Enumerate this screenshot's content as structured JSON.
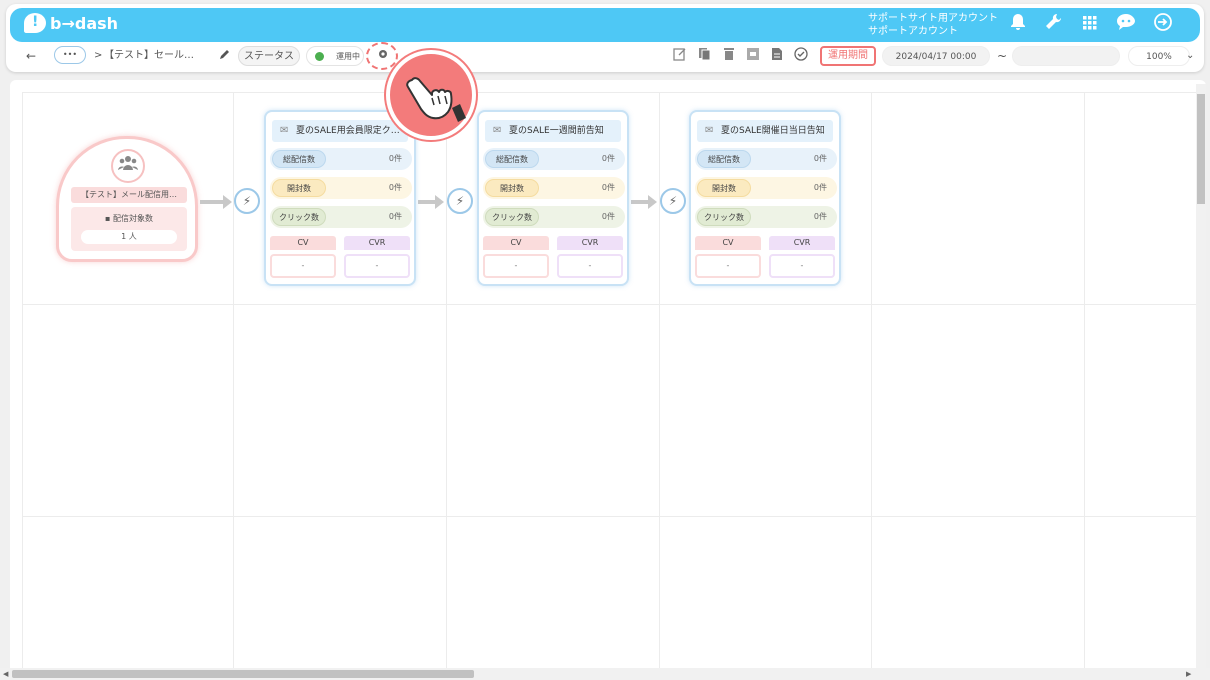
{
  "brand": {
    "logo_text": "b→dash"
  },
  "account": {
    "line1": "サポートサイト用アカウント",
    "line2": "サポートアカウント"
  },
  "header_icons": [
    "bell-icon",
    "wrench-icon",
    "grid-icon",
    "chat-icon",
    "logout-icon"
  ],
  "toolbar": {
    "back": "←",
    "more": "•••",
    "breadcrumb_sep": ">",
    "breadcrumb": "【テスト】セール…",
    "status_label": "ステータス",
    "status_value": "運用中",
    "period_button": "運用期間",
    "start_date": "2024/04/17 00:00",
    "tilde": "~",
    "end_date": "",
    "zoom": "100%"
  },
  "start_node": {
    "title": "【テスト】メール配信用…",
    "sub_label": "配信対象数",
    "sub_value": "1 人"
  },
  "mail_nodes": [
    {
      "title": "夏のSALE用会員限定ク…",
      "rows": [
        {
          "label": "総配信数",
          "value": "0件"
        },
        {
          "label": "開封数",
          "value": "0件"
        },
        {
          "label": "クリック数",
          "value": "0件"
        }
      ],
      "cv_label": "CV",
      "cv_value": "-",
      "cvr_label": "CVR",
      "cvr_value": "-"
    },
    {
      "title": "夏のSALE一週間前告知",
      "rows": [
        {
          "label": "総配信数",
          "value": "0件"
        },
        {
          "label": "開封数",
          "value": "0件"
        },
        {
          "label": "クリック数",
          "value": "0件"
        }
      ],
      "cv_label": "CV",
      "cv_value": "-",
      "cvr_label": "CVR",
      "cvr_value": "-"
    },
    {
      "title": "夏のSALE開催日当日告知",
      "rows": [
        {
          "label": "総配信数",
          "value": "0件"
        },
        {
          "label": "開封数",
          "value": "0件"
        },
        {
          "label": "クリック数",
          "value": "0件"
        }
      ],
      "cv_label": "CV",
      "cv_value": "-",
      "cvr_label": "CVR",
      "cvr_value": "-"
    }
  ],
  "colors": {
    "header": "#4ec8f5",
    "accent": "#f07474"
  }
}
